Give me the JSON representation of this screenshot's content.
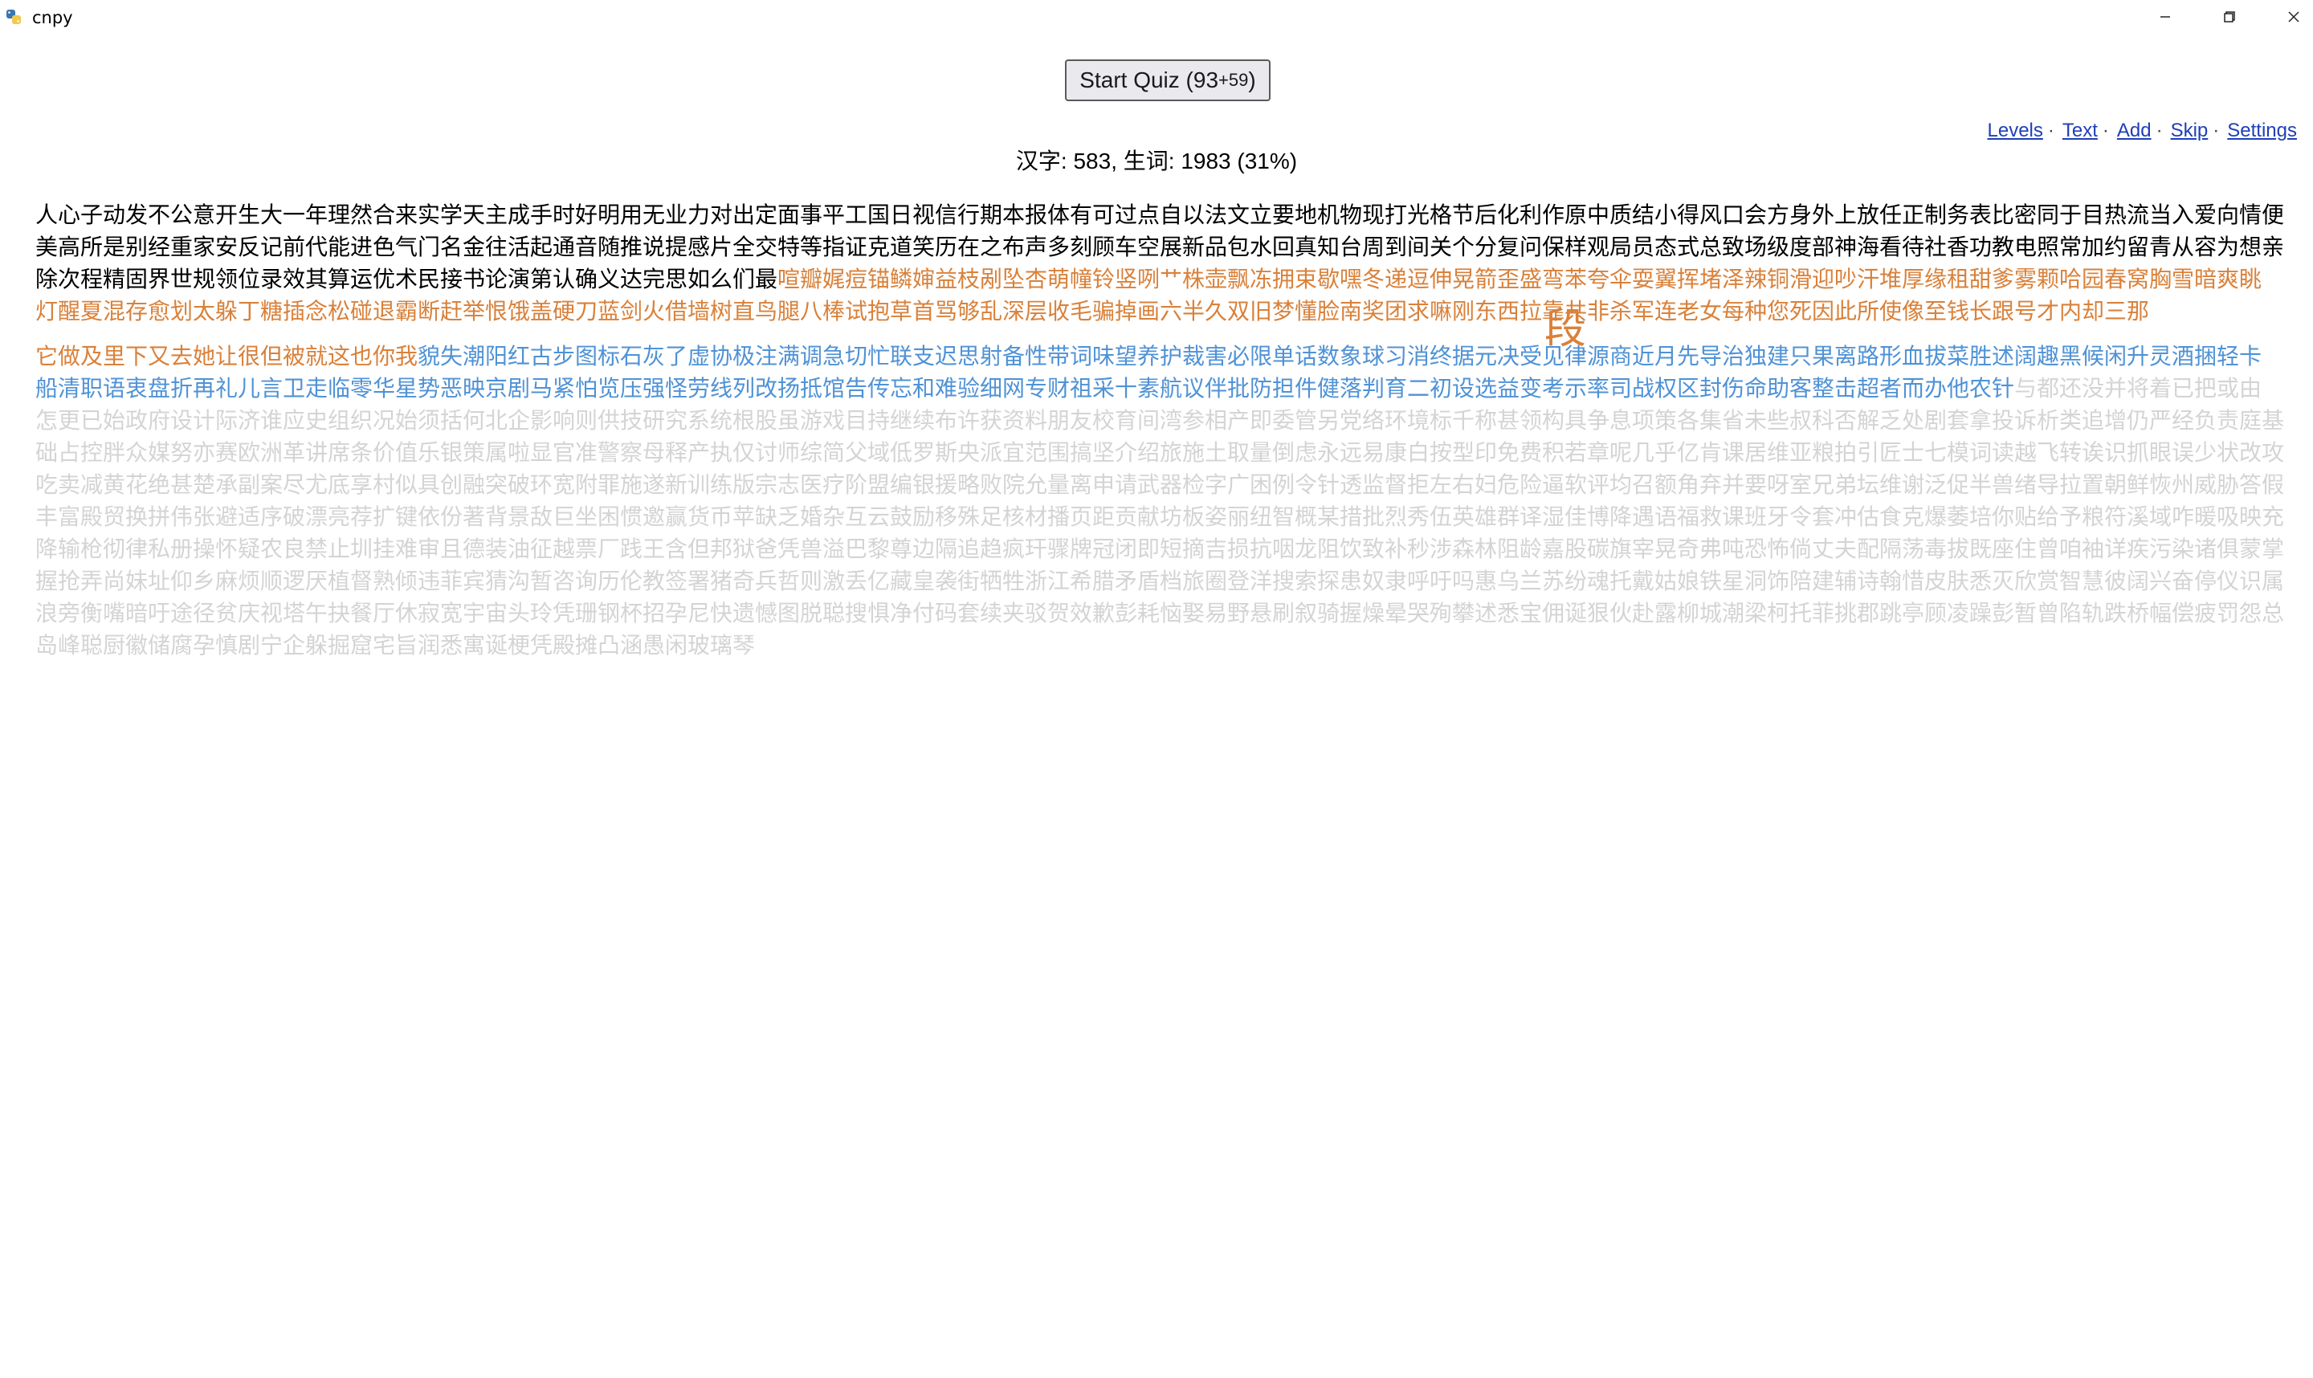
{
  "window": {
    "title": "cnpy",
    "app_icon": "python-icon",
    "controls": [
      "minimize-icon",
      "maximize-icon",
      "close-icon"
    ]
  },
  "quiz_button": {
    "label": "Start Quiz (93",
    "suffix": "+59",
    "close": ")"
  },
  "nav": {
    "links": [
      "Levels",
      "Text",
      "Add",
      "Skip",
      "Settings"
    ],
    "separator": "·"
  },
  "stats": {
    "text": "汉字: 583, 生词: 1983 (31%)"
  },
  "colors": {
    "known": "#000000",
    "learning": "#d9813a",
    "new": "#4f92d6",
    "unseen": "#d4d4d4",
    "link": "#1f3fb8"
  },
  "highlight_char": "段",
  "characters": {
    "p1_known": "人心子动发不公意开生大一年理然合来实学天主成手时好明用无业力对出定面事平工国日视信行期本报体有可过点自以法文立要地机物现打光格节后化利作原中质结小得风口会方身外上放任正制务表比密同于目热流当入爱向情便美高所是别经重家安反记前代能进色气门名金往活起通音随推说提感片全交特等指证克道笑历在之布声多刻顾车空展新品包水回真知台周到间关个分复问保样观局员态式总致场级度部神海看待社香功教电照常加约留青从容为想亲除次程精固界世规领位录效其算运优术民接书论演第认确义达完思如么们最",
    "p1_learning": "喧瓣娓痘锚鳞婶益枝剐坠杏萌幢铃竖咧艹株壶飘冻拥束歇嘿冬递逗伸晃箭歪盛弯苯夸伞耍翼挥堵泽辣铜滑迎吵汗堆厚缘租甜爹雾颗哈园春窝胸雪暗爽眺灯醒夏混存愈划太躲丁糖插念松碰退霸断赶举恨饿盖硬刀蓝剑火借墙树直鸟腿八棒试抱草首骂够乱深层收毛骗掉画六半久双旧梦懂脸南奖团求嘛刚",
    "p1_learning_tail": "东西拉靠共非杀军连老女每种您死因此所使像至钱长跟号才内却三那",
    "p2_learning": "它做及里下又去她让很但被就这也你我",
    "p2_new": "貌失潮阳红古步图标石灰了虚协极注满调急切忙联支迟思射备性带词味望养护裁害必限单话数象球习消终据元决受见律源商近月先导治独建只果离路形血拔菜胜述阔趣黑候闲升灵酒捆轻卡船清职语衷盘折再礼儿言卫走临零华星势恶映京剧马紧怕览压强怪劳线列改扬抵馆告传忘和难验细网专财祖采十素航议伴批防担件健落判育二初设选益变考示率司战权区封伤命助客整击超者而办他农针",
    "p2_unseen": "与都还没并将着已把或由怎更已始政府设计际济谁应史组织况始须括何北企影响则供技研究系统根股虽游戏目持继续布许获资料朋友校育间湾参相产即委管另党络环境标千称甚领构具争息项策各集省未些叔科否解乏处剧套拿投诉析类追增仍严经负责庭基础占控胖众媒努亦赛欧洲革讲席条价值乐银策属啦显官准警察母释产执仅讨师综简父域低罗斯央派宜范围搞坚介绍旅施土取量倒虑永远易康白按型印免费积若章呢几乎亿肯课居维亚粮拍引匠士七模词读越飞转诶识抓眼误少状改攻吃卖减黄花绝甚楚承副案尽尤底享村似具创融突破环宽附罪施遂新训练版宗志医疗阶盟编银援略败院允量离申请武器检字广困例令针透监督拒左右妇危险逼软评均召额角弃并要呀室兄弟坛维谢泛促半兽绪导拉置朝鲜恢州威胁答假丰富殿贸换拼伟张避适序破漂亮荐扩键依份著背景敌巨坐困惯邀赢货币苹缺乏婚杂互云鼓励移殊足核材播页距贡献坊板姿丽纽智概某措批烈秀伍英雄群译湿佳博降遇语福救课班牙令套冲估食克爆萎培你贴给予粮符溪域咋暖吸映充降输枪彻律私册操怀疑农良禁止圳挂难审且德装油征越票厂践王含但邦狱爸凭兽溢巴黎尊边隔追趋疯玕骤牌冠闭即短摘吉损抗咽龙阻饮致补秒涉森林阻龄嘉股碳旗宰晃奇弗吨恐怖倘丈夫配隔荡毒拔既座住曾咱袖详疾污染诸俱蒙掌握抢弄尚妹址仰乡麻烦顺逻厌植督熟倾违菲宾猜沟暂咨询历伦教签署猪奇兵哲则激丢亿藏皇袭街牺牲浙江希腊矛盾档旅圈登洋搜索探患奴隶呼吁吗惠乌兰苏纷魂托戴姑娘铁星洞饰陪建辅诗翰惜皮肤悉灭欣赏智慧彼阔兴奋停仪识属浪旁衡嘴暗吁途径贫庆视塔午抉餐厅休寂宽宇宙头玲凭珊钢杯招孕尼快遗憾图脱聪搜惧净付码套续夹驳贺效歉彭耗恼娶易野悬刷叙骑握燥晕哭殉攀述悉宝佣诞狠伙赴露柳城潮梁柯托菲挑郡跳亭顾凌躁彭暂曾陷轨跌桥幅偿疲罚怨总岛峰聪厨徽储腐孕慎剧宁企躲掘窟宅旨润悉寓诞梗凭殿摊凸涵愚闲玻璃琴"
  }
}
